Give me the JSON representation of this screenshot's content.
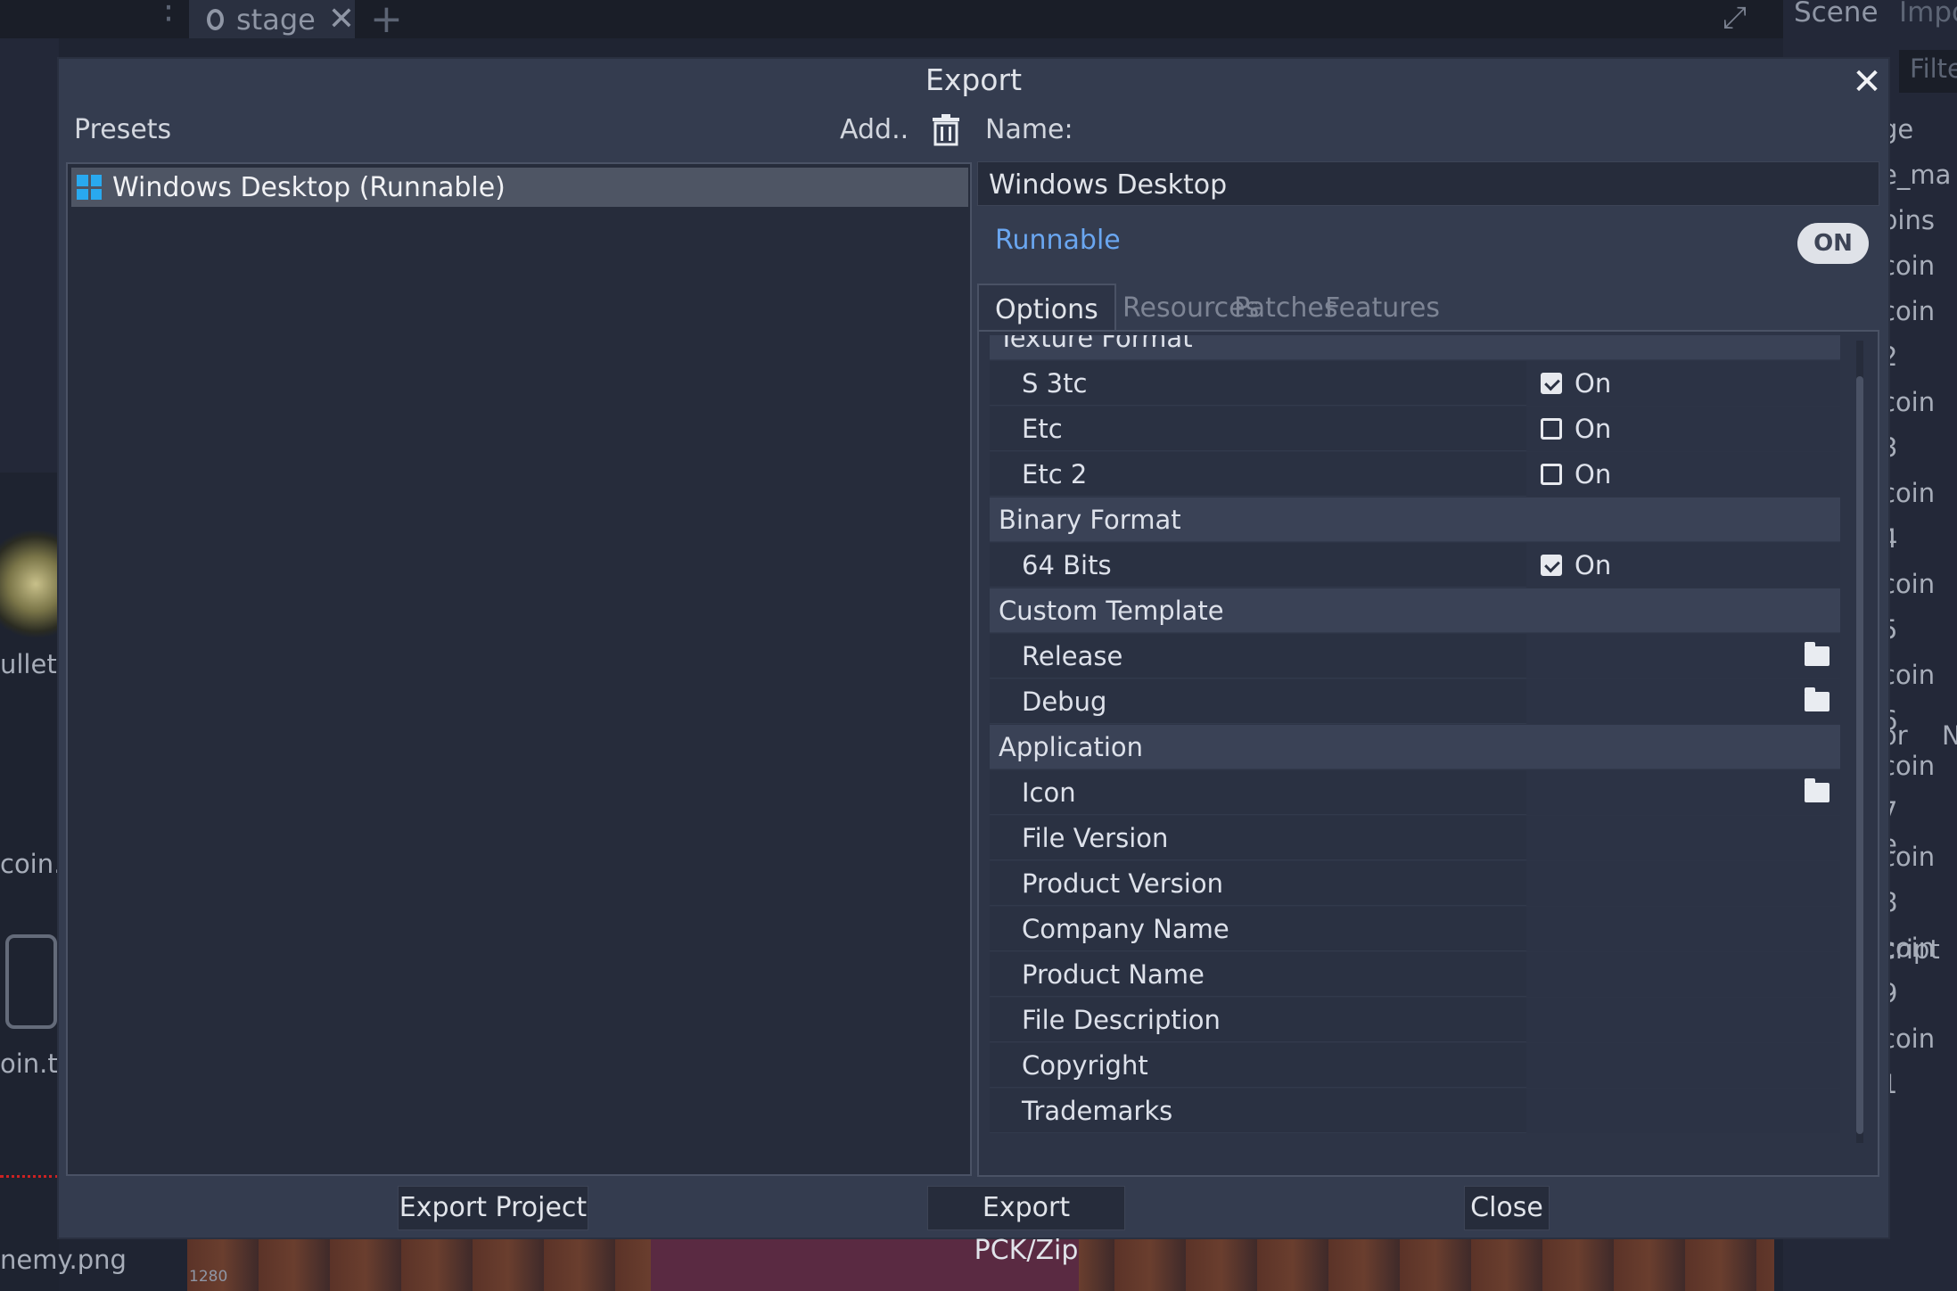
{
  "background": {
    "scene_tab": "stage",
    "right_tabs": [
      "Scene",
      "Impo"
    ],
    "filter_placeholder": "Filte",
    "right_list": [
      "ge",
      "e_ma",
      "pins",
      "coin",
      "coin 2",
      "coin 3",
      "coin 4",
      "coin 5",
      "coin 6",
      "coin 7",
      "coin 8",
      "coin 9",
      "coin 1"
    ],
    "right_lower": [
      "or",
      "N",
      "e",
      "cript"
    ],
    "left_files": [
      "ullet.p",
      "coin.g",
      "oin.ts",
      "nemy.png"
    ],
    "ruler_value": "1280"
  },
  "dialog": {
    "title": "Export",
    "presets_label": "Presets",
    "add_label": "Add..",
    "name_label": "Name:",
    "presets": [
      {
        "name": "Windows Desktop (Runnable)",
        "selected": true
      }
    ],
    "name_value": "Windows Desktop",
    "runnable_label": "Runnable",
    "runnable_toggle": "ON",
    "tabs": [
      "Options",
      "Resources",
      "Patches",
      "Features"
    ],
    "active_tab": "Options",
    "options": {
      "texture_section": "Texture Format",
      "s3tc_label": "S 3tc",
      "etc_label": "Etc",
      "etc2_label": "Etc 2",
      "binary_section": "Binary Format",
      "bits64_label": "64 Bits",
      "custom_section": "Custom Template",
      "release_label": "Release",
      "debug_label": "Debug",
      "application_section": "Application",
      "icon_label": "Icon",
      "file_version_label": "File Version",
      "product_version_label": "Product Version",
      "company_name_label": "Company Name",
      "product_name_label": "Product Name",
      "file_description_label": "File Description",
      "copyright_label": "Copyright",
      "trademarks_label": "Trademarks",
      "on_text": "On",
      "s3tc_checked": true,
      "etc_checked": false,
      "etc2_checked": false,
      "bits64_checked": true
    },
    "buttons": {
      "export_project": "Export Project",
      "export_pck": "Export PCK/Zip",
      "close": "Close"
    }
  }
}
